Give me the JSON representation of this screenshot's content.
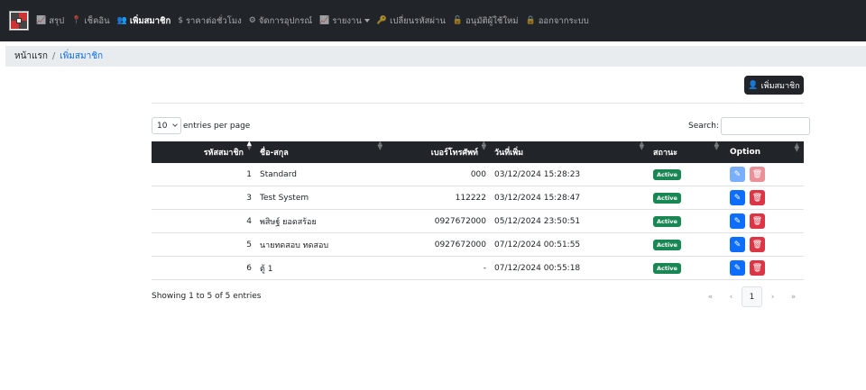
{
  "nav": {
    "items": [
      {
        "icon": "chart-icon",
        "glyph": "📈",
        "label": "สรุป",
        "active": false
      },
      {
        "icon": "location-icon",
        "glyph": "📍",
        "label": "เช็คอิน",
        "active": false
      },
      {
        "icon": "users-icon",
        "glyph": "👥",
        "label": "เพิ่มสมาชิก",
        "active": true
      },
      {
        "icon": "dollar-icon",
        "glyph": "$",
        "label": "ราคาต่อชั่วโมง",
        "active": false
      },
      {
        "icon": "tools-icon",
        "glyph": "⚙",
        "label": "จัดการอุปกรณ์",
        "active": false
      },
      {
        "icon": "report-icon",
        "glyph": "📈",
        "label": "รายงาน",
        "active": false,
        "dropdown": true
      },
      {
        "icon": "key-icon",
        "glyph": "🔑",
        "label": "เปลี่ยนรหัสผ่าน",
        "active": false
      },
      {
        "icon": "unlock-icon",
        "glyph": "🔓",
        "label": "อนุมัติผู้ใช้ใหม่",
        "active": false
      },
      {
        "icon": "lock-icon",
        "glyph": "🔒",
        "label": "ออกจากระบบ",
        "active": false
      }
    ]
  },
  "breadcrumb": {
    "home": "หน้าแรก",
    "separator": "/",
    "current": "เพิ่มสมาชิก"
  },
  "add_button": {
    "label": "เพิ่มสมาชิก"
  },
  "table_controls": {
    "length_value": "10",
    "length_suffix": "entries per page",
    "search_label": "Search:",
    "search_value": ""
  },
  "table": {
    "headers": [
      "รหัสสมาชิก",
      "ชื่อ-สกุล",
      "เบอร์โทรศัพท์",
      "วันที่เพิ่ม",
      "สถานะ",
      "Option"
    ],
    "rows": [
      {
        "id": "1",
        "name": "Standard",
        "phone": "000",
        "date": "03/12/2024 15:28:23",
        "status": "Active",
        "disabled": true
      },
      {
        "id": "3",
        "name": "Test System",
        "phone": "112222",
        "date": "03/12/2024 15:28:47",
        "status": "Active",
        "disabled": false
      },
      {
        "id": "4",
        "name": "พสิษฐ์ ยอดสร้อย",
        "phone": "0927672000",
        "date": "05/12/2024 23:50:51",
        "status": "Active",
        "disabled": false
      },
      {
        "id": "5",
        "name": "นายทดสอบ ทดสอบ",
        "phone": "0927672000",
        "date": "07/12/2024 00:51:55",
        "status": "Active",
        "disabled": false
      },
      {
        "id": "6",
        "name": "ตู้ 1",
        "phone": "-",
        "date": "07/12/2024 00:55:18",
        "status": "Active",
        "disabled": false
      }
    ]
  },
  "footer": {
    "info": "Showing 1 to 5 of 5 entries"
  },
  "pagination": {
    "first": "«",
    "prev": "‹",
    "current": "1",
    "next": "›",
    "last": "»"
  }
}
